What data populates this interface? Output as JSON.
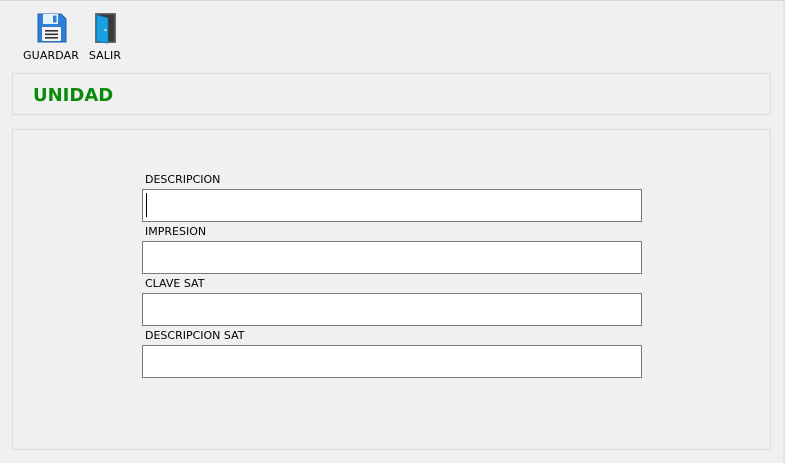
{
  "toolbar": {
    "save_label": "GUARDAR",
    "exit_label": "SALIR",
    "save_icon": "floppy-disk-icon",
    "exit_icon": "exit-door-icon"
  },
  "header": {
    "title": "UNIDAD",
    "title_color": "#0a8a0a"
  },
  "form": {
    "fields": [
      {
        "label": "DESCRIPCION",
        "value": ""
      },
      {
        "label": "IMPRESION",
        "value": ""
      },
      {
        "label": "CLAVE SAT",
        "value": ""
      },
      {
        "label": "DESCRIPCION SAT",
        "value": ""
      }
    ]
  }
}
